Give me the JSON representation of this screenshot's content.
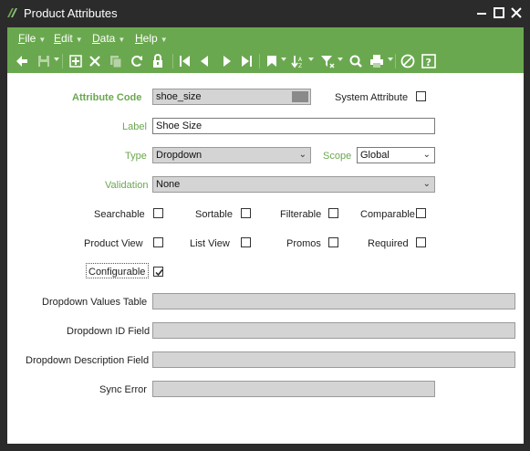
{
  "window": {
    "title": "Product Attributes",
    "colors": {
      "accent": "#6aa84f",
      "frame": "#2b2b2b"
    }
  },
  "menu": [
    {
      "label": "File",
      "u": "F",
      "rest": "ile"
    },
    {
      "label": "Edit",
      "u": "E",
      "rest": "dit"
    },
    {
      "label": "Data",
      "u": "D",
      "rest": "ata"
    },
    {
      "label": "Help",
      "u": "H",
      "rest": "elp"
    }
  ],
  "toolbar_icons": [
    "back-arrow-icon",
    "save-icon",
    "add-icon",
    "delete-icon",
    "copy-icon",
    "refresh-icon",
    "lock-icon",
    "first-record-icon",
    "previous-record-icon",
    "next-record-icon",
    "last-record-icon",
    "bookmark-icon",
    "sort-icon",
    "filter-icon",
    "search-icon",
    "print-icon",
    "help-assist-icon",
    "help-question-icon"
  ],
  "form": {
    "attribute_code": {
      "label": "Attribute Code",
      "value": "shoe_size"
    },
    "system_attribute": {
      "label": "System Attribute",
      "checked": false
    },
    "label": {
      "label": "Label",
      "value": "Shoe Size"
    },
    "type": {
      "label": "Type",
      "value": "Dropdown"
    },
    "scope": {
      "label": "Scope",
      "value": "Global"
    },
    "validation": {
      "label": "Validation",
      "value": "None"
    },
    "searchable": {
      "label": "Searchable",
      "checked": false
    },
    "sortable": {
      "label": "Sortable",
      "checked": false
    },
    "filterable": {
      "label": "Filterable",
      "checked": false
    },
    "comparable": {
      "label": "Comparable",
      "checked": false
    },
    "product_view": {
      "label": "Product View",
      "checked": false
    },
    "list_view": {
      "label": "List View",
      "checked": false
    },
    "promos": {
      "label": "Promos",
      "checked": false
    },
    "required": {
      "label": "Required",
      "checked": false
    },
    "configurable": {
      "label": "Configurable",
      "checked": true
    },
    "dropdown_values_table": {
      "label": "Dropdown Values Table",
      "value": ""
    },
    "dropdown_id_field": {
      "label": "Dropdown ID Field",
      "value": ""
    },
    "dropdown_description_field": {
      "label": "Dropdown Description Field",
      "value": ""
    },
    "sync_error": {
      "label": "Sync Error",
      "value": ""
    }
  }
}
